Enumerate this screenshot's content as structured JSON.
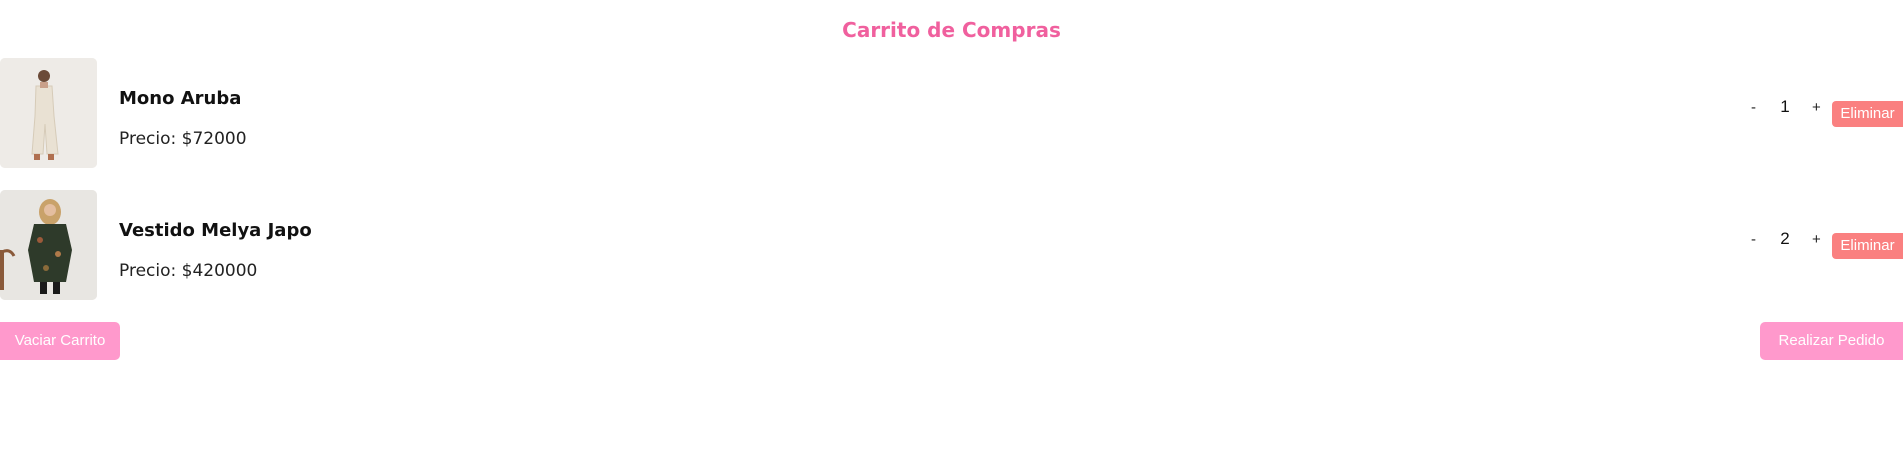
{
  "cart": {
    "title": "Carrito de Compras",
    "items": [
      {
        "name": "Mono Aruba",
        "price": "Precio: $72000",
        "quantity": "1",
        "decrement_label": "-",
        "increment_label": "+",
        "remove_label": "Eliminar"
      },
      {
        "name": "Vestido Melya Japo",
        "price": "Precio: $420000",
        "quantity": "2",
        "decrement_label": "-",
        "increment_label": "+",
        "remove_label": "Eliminar"
      }
    ],
    "empty_cart_label": "Vaciar Carrito",
    "place_order_label": "Realizar Pedido"
  },
  "colors": {
    "title": "#f0609e",
    "remove_button": "#fa8080",
    "action_button": "#ff99cc"
  }
}
